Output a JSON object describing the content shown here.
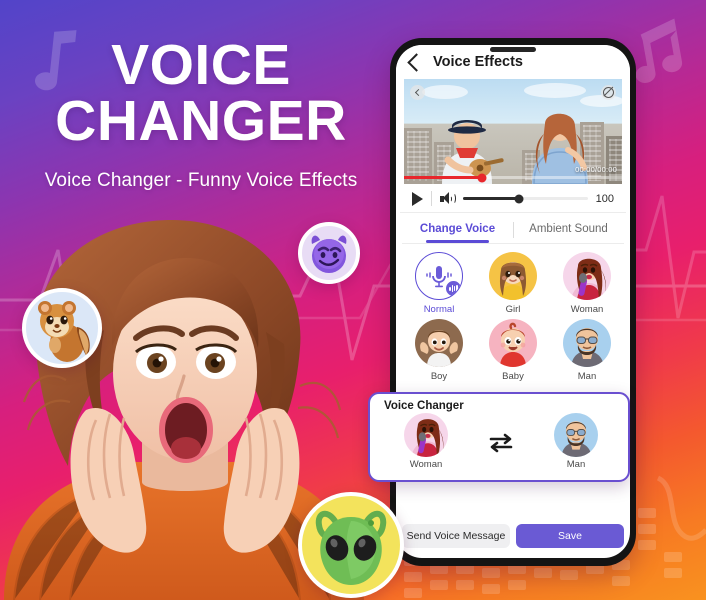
{
  "poster": {
    "title_line1": "VOICE",
    "title_line2": "CHANGER",
    "subtitle": "Voice Changer - Funny Voice Effects",
    "colors": {
      "gradient_top": "#5244c9",
      "gradient_mid": "#d71f7e",
      "gradient_bottom": "#f9921f",
      "accent_purple": "#5b4bd6",
      "progress_red": "#e8262b"
    },
    "decor": {
      "note_left": "note-icon",
      "note_right": "double-note-icon"
    }
  },
  "bubbles": [
    {
      "name": "chipmunk-emoji",
      "label": "Chipmunk",
      "bg": "#dbe7f7"
    },
    {
      "name": "devil-emoji",
      "label": "Devil",
      "bg": "#e8dcf5"
    },
    {
      "name": "alien-emoji",
      "label": "Alien",
      "bg": "#f3e35c"
    }
  ],
  "phone": {
    "appbar": {
      "back_icon": "back-chevron-icon",
      "title": "Voice Effects"
    },
    "video": {
      "prev_icon": "chevron-left-icon",
      "mute_icon": "mute-icon",
      "timestamp": "00:00/00:00",
      "progress_percent": 36
    },
    "controls": {
      "play_icon": "play-icon",
      "volume_icon": "volume-icon",
      "volume_value": "100",
      "volume_percent": 45
    },
    "tabs": [
      {
        "label": "Change Voice",
        "active": true
      },
      {
        "label": "Ambient Sound",
        "active": false
      }
    ],
    "voices": [
      {
        "label": "Normal",
        "selected": true,
        "icon": "microphone-icon"
      },
      {
        "label": "Girl",
        "selected": false,
        "icon": "girl-avatar"
      },
      {
        "label": "Woman",
        "selected": false,
        "icon": "woman-avatar"
      },
      {
        "label": "Boy",
        "selected": false,
        "icon": "boy-avatar"
      },
      {
        "label": "Baby",
        "selected": false,
        "icon": "baby-avatar"
      },
      {
        "label": "Man",
        "selected": false,
        "icon": "man-avatar"
      }
    ],
    "voice_changer_card": {
      "title": "Voice Changer",
      "from_label": "Woman",
      "to_label": "Man",
      "swap_icon": "swap-arrows-icon"
    },
    "actions": {
      "send_label": "Send Voice Message",
      "save_label": "Save"
    }
  }
}
